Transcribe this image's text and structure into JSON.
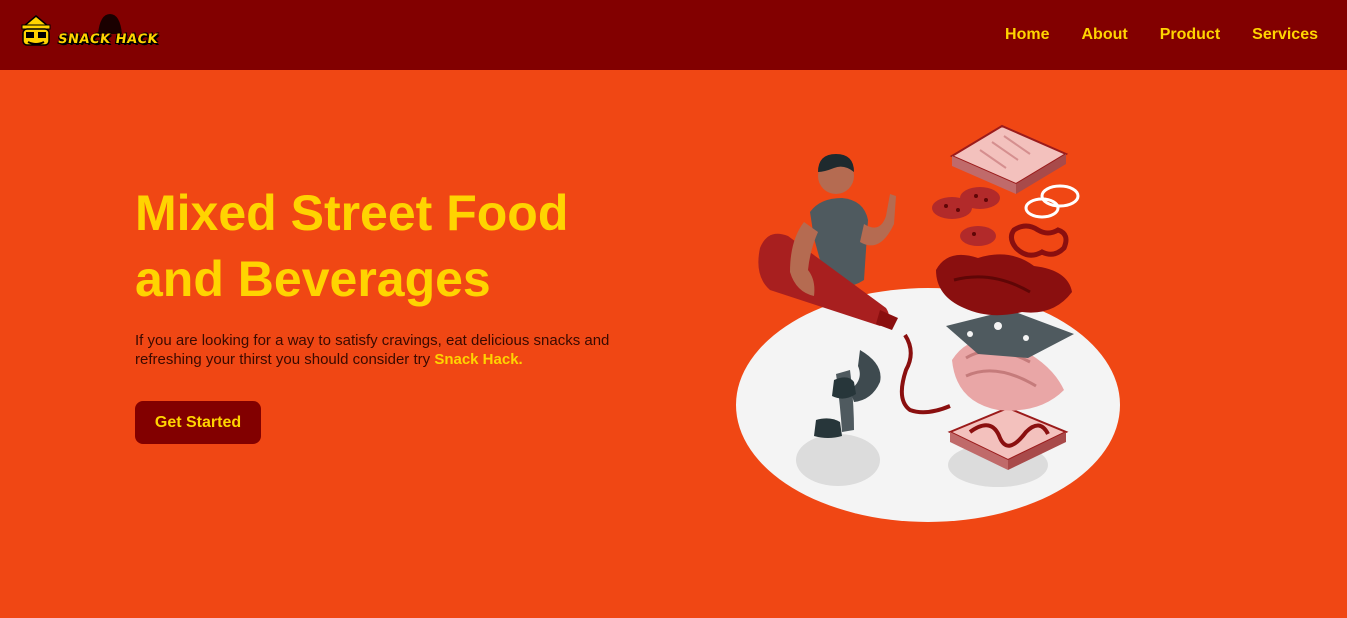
{
  "header": {
    "logo_text": "SNACK HACK",
    "nav": [
      {
        "label": "Home"
      },
      {
        "label": "About"
      },
      {
        "label": "Product"
      },
      {
        "label": "Services"
      }
    ]
  },
  "hero": {
    "title": "Mixed Street Food and Beverages",
    "description": "If you are looking for a way to satisfy cravings, eat delicious snacks and refreshing your thirst you should consider try ",
    "brand_highlight": "Snack Hack.",
    "cta_label": "Get Started"
  },
  "colors": {
    "background": "#f04714",
    "navbar": "#820000",
    "accent_yellow": "#ffd400",
    "button": "#820000"
  },
  "icons": {
    "logo": "snack-hack-logo-icon",
    "illustration": "person-with-ketchup-and-sandwich-illustration"
  }
}
